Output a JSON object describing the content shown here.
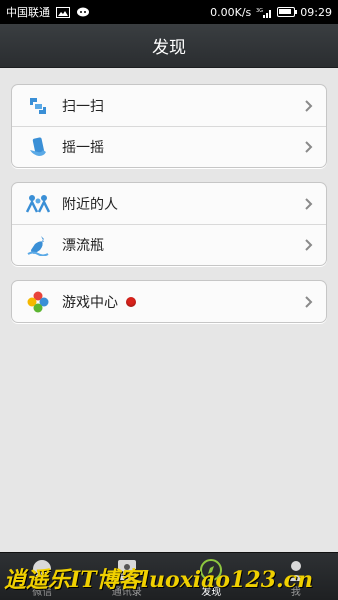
{
  "status_bar": {
    "carrier": "中国联通",
    "speed": "0.00K/s",
    "network": "3G",
    "time": "09:29",
    "battery_level": 0.9
  },
  "header": {
    "title": "发现"
  },
  "groups": [
    {
      "items": [
        {
          "label": "扫一扫",
          "icon": "scan-icon"
        },
        {
          "label": "摇一摇",
          "icon": "shake-icon"
        }
      ]
    },
    {
      "items": [
        {
          "label": "附近的人",
          "icon": "people-nearby-icon"
        },
        {
          "label": "漂流瓶",
          "icon": "drift-bottle-icon"
        }
      ]
    },
    {
      "items": [
        {
          "label": "游戏中心",
          "icon": "game-center-icon",
          "badge": "red-dot"
        }
      ]
    }
  ],
  "tabs": [
    {
      "label": "微信",
      "icon": "chat-icon",
      "active": false
    },
    {
      "label": "通讯录",
      "icon": "contacts-icon",
      "active": false
    },
    {
      "label": "发现",
      "icon": "compass-icon",
      "active": true
    },
    {
      "label": "我",
      "icon": "person-icon",
      "active": false
    }
  ],
  "watermark": "逍遥乐IT博客luoxiao123.cn",
  "colors": {
    "header_bg": "#2f3235",
    "page_bg": "#e6e6e6",
    "badge_red": "#d8221b",
    "icon_blue": "#3a8fd6",
    "active_tab_green": "#8ec63f"
  }
}
